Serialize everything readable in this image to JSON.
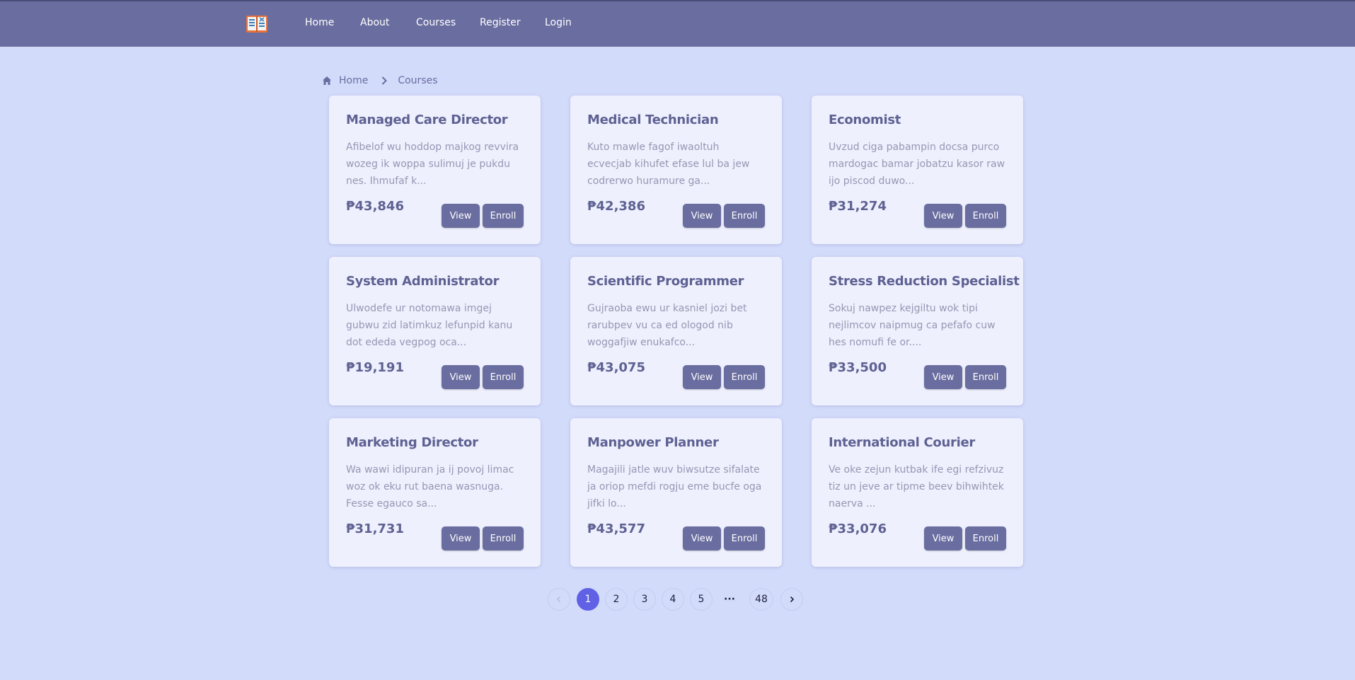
{
  "nav": {
    "logo_icon": "book-logo-icon",
    "links": [
      "Home",
      "About",
      "Courses",
      "Register",
      "Login"
    ]
  },
  "breadcrumb": {
    "home_icon": "home-icon",
    "home": "Home",
    "separator_icon": "chevron-right-icon",
    "current": "Courses"
  },
  "courses": [
    {
      "title": "Managed Care Director",
      "desc": "Afibelof wu hoddop majkog revvira wozeg ik woppa sulimuj je pukdu nes. Ihmufaf k...",
      "price": "₱43,846",
      "view": "View",
      "enroll": "Enroll"
    },
    {
      "title": "Medical Technician",
      "desc": "Kuto mawle fagof iwaoltuh ecvecjab kihufet efase lul ba jew codrerwo huramure ga...",
      "price": "₱42,386",
      "view": "View",
      "enroll": "Enroll"
    },
    {
      "title": "Economist",
      "desc": "Uvzud ciga pabampin docsa purco mardogac bamar jobatzu kasor raw ijo piscod duwo...",
      "price": "₱31,274",
      "view": "View",
      "enroll": "Enroll"
    },
    {
      "title": "System Administrator",
      "desc": "Ulwodefe ur notomawa imgej gubwu zid latimkuz lefunpid kanu dot ededa vegpog oca...",
      "price": "₱19,191",
      "view": "View",
      "enroll": "Enroll"
    },
    {
      "title": "Scientific Programmer",
      "desc": "Gujraoba ewu ur kasniel jozi bet rarubpev vu ca ed ologod nib woggafjiw enukafco...",
      "price": "₱43,075",
      "view": "View",
      "enroll": "Enroll"
    },
    {
      "title": "Stress Reduction Specialist",
      "desc": "Sokuj nawpez kejgiltu wok tipi nejlimcov naipmug ca pefafo cuw hes nomufi fe or....",
      "price": "₱33,500",
      "view": "View",
      "enroll": "Enroll"
    },
    {
      "title": "Marketing Director",
      "desc": "Wa wawi idipuran ja ij povoj limac woz ok eku rut baena wasnuga. Fesse egauco sa...",
      "price": "₱31,731",
      "view": "View",
      "enroll": "Enroll"
    },
    {
      "title": "Manpower Planner",
      "desc": "Magajili jatle wuv biwsutze sifalate ja oriop mefdi rogju eme bucfe oga jifki lo...",
      "price": "₱43,577",
      "view": "View",
      "enroll": "Enroll"
    },
    {
      "title": "International Courier",
      "desc": "Ve oke zejun kutbak ife egi refzivuz tiz un jeve ar tipme beev bihwihtek naerva ...",
      "price": "₱33,076",
      "view": "View",
      "enroll": "Enroll"
    }
  ],
  "pagination": {
    "prev_icon": "chevron-left-icon",
    "pages": [
      "1",
      "2",
      "3",
      "4",
      "5"
    ],
    "current_page": "1",
    "ellipsis": "···",
    "last": "48",
    "next_icon": "chevron-right-icon"
  },
  "colors": {
    "background": "#d3dbfb",
    "header": "#6a6d9f",
    "card": "#eef0fd",
    "button": "#6a6d9f",
    "active_page": "#6161e6"
  }
}
